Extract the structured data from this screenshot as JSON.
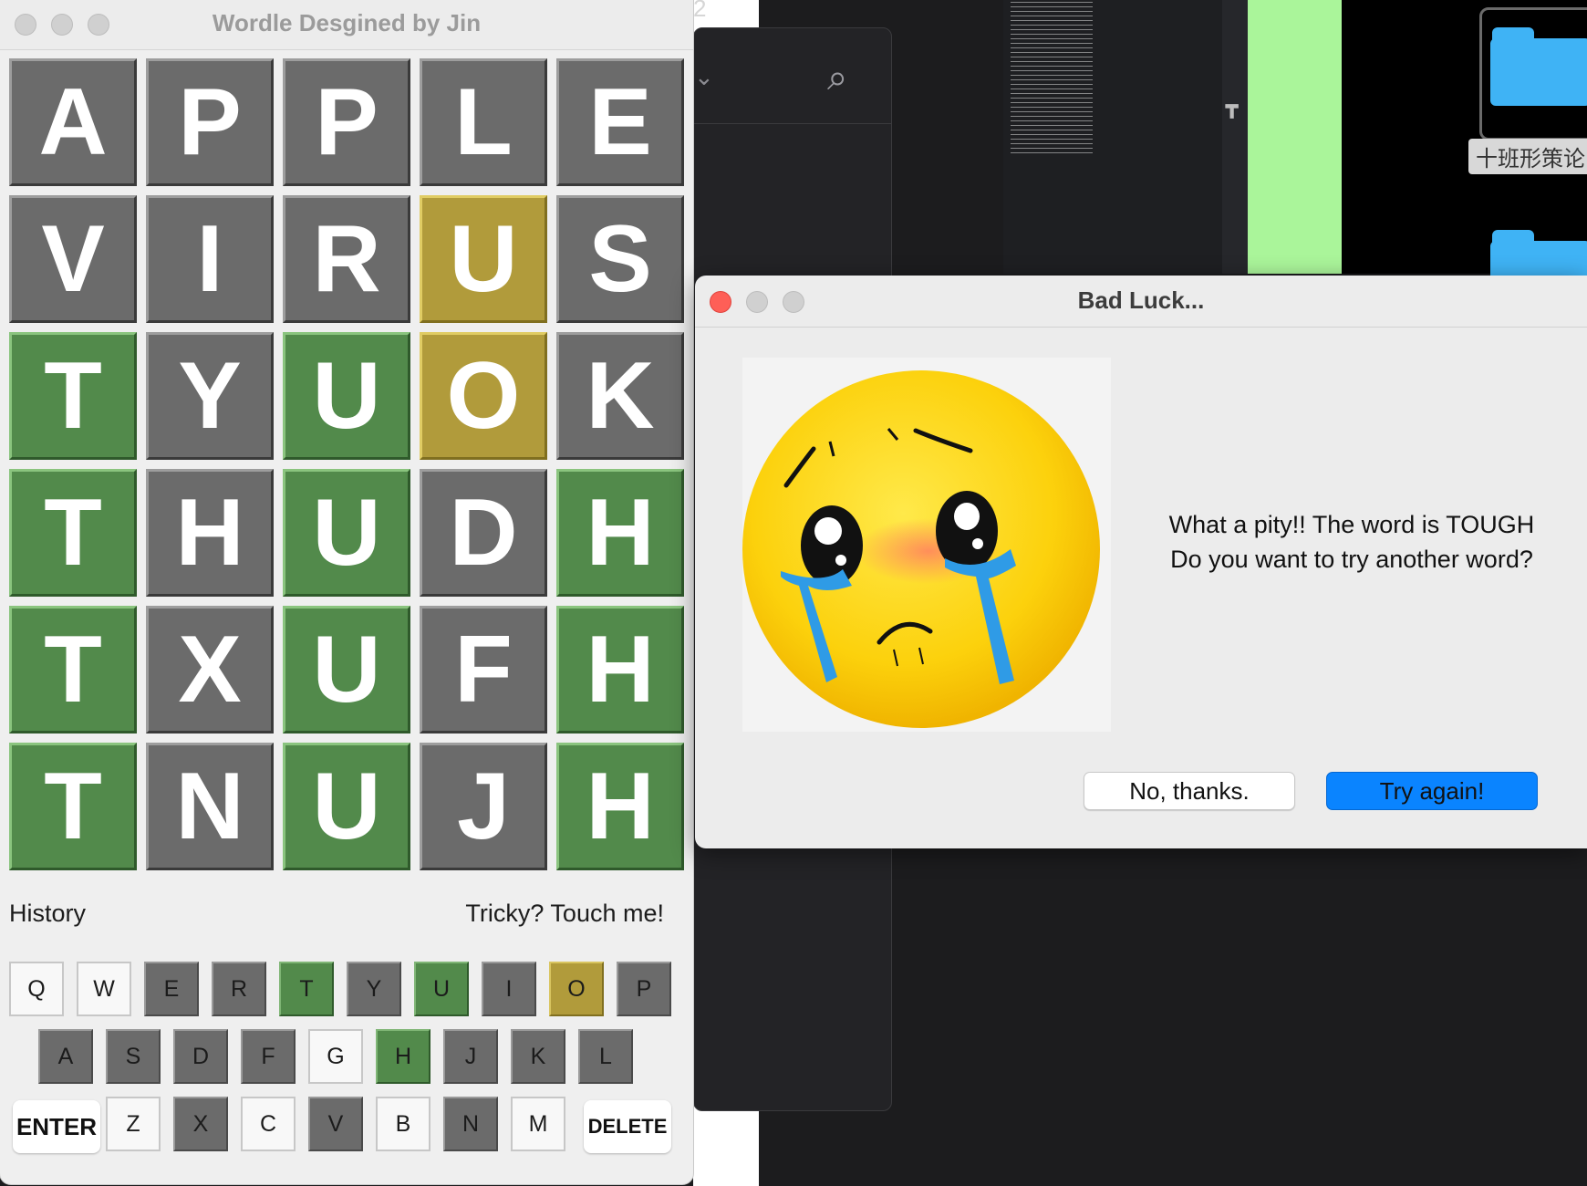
{
  "window": {
    "title": "Wordle Desgined by Jin"
  },
  "board": {
    "rows": [
      [
        {
          "letter": "A",
          "state": "gray"
        },
        {
          "letter": "P",
          "state": "gray"
        },
        {
          "letter": "P",
          "state": "gray"
        },
        {
          "letter": "L",
          "state": "gray"
        },
        {
          "letter": "E",
          "state": "gray"
        }
      ],
      [
        {
          "letter": "V",
          "state": "gray"
        },
        {
          "letter": "I",
          "state": "gray"
        },
        {
          "letter": "R",
          "state": "gray"
        },
        {
          "letter": "U",
          "state": "yellow"
        },
        {
          "letter": "S",
          "state": "gray"
        }
      ],
      [
        {
          "letter": "T",
          "state": "green"
        },
        {
          "letter": "Y",
          "state": "gray"
        },
        {
          "letter": "U",
          "state": "green"
        },
        {
          "letter": "O",
          "state": "yellow"
        },
        {
          "letter": "K",
          "state": "gray"
        }
      ],
      [
        {
          "letter": "T",
          "state": "green"
        },
        {
          "letter": "H",
          "state": "gray"
        },
        {
          "letter": "U",
          "state": "green"
        },
        {
          "letter": "D",
          "state": "gray"
        },
        {
          "letter": "H",
          "state": "green"
        }
      ],
      [
        {
          "letter": "T",
          "state": "green"
        },
        {
          "letter": "X",
          "state": "gray"
        },
        {
          "letter": "U",
          "state": "green"
        },
        {
          "letter": "F",
          "state": "gray"
        },
        {
          "letter": "H",
          "state": "green"
        }
      ],
      [
        {
          "letter": "T",
          "state": "green"
        },
        {
          "letter": "N",
          "state": "gray"
        },
        {
          "letter": "U",
          "state": "green"
        },
        {
          "letter": "J",
          "state": "gray"
        },
        {
          "letter": "H",
          "state": "green"
        }
      ]
    ]
  },
  "links": {
    "history": "History",
    "tricky": "Tricky? Touch me!"
  },
  "keyboard": {
    "row1": [
      {
        "k": "Q",
        "s": "white"
      },
      {
        "k": "W",
        "s": "white"
      },
      {
        "k": "E",
        "s": "gray"
      },
      {
        "k": "R",
        "s": "gray"
      },
      {
        "k": "T",
        "s": "green"
      },
      {
        "k": "Y",
        "s": "gray"
      },
      {
        "k": "U",
        "s": "green"
      },
      {
        "k": "I",
        "s": "gray"
      },
      {
        "k": "O",
        "s": "yellow"
      },
      {
        "k": "P",
        "s": "gray"
      }
    ],
    "row2": [
      {
        "k": "A",
        "s": "gray"
      },
      {
        "k": "S",
        "s": "gray"
      },
      {
        "k": "D",
        "s": "gray"
      },
      {
        "k": "F",
        "s": "gray"
      },
      {
        "k": "G",
        "s": "white"
      },
      {
        "k": "H",
        "s": "green"
      },
      {
        "k": "J",
        "s": "gray"
      },
      {
        "k": "K",
        "s": "gray"
      },
      {
        "k": "L",
        "s": "gray"
      }
    ],
    "row3": [
      {
        "k": "Z",
        "s": "white"
      },
      {
        "k": "X",
        "s": "gray"
      },
      {
        "k": "C",
        "s": "white"
      },
      {
        "k": "V",
        "s": "gray"
      },
      {
        "k": "B",
        "s": "white"
      },
      {
        "k": "N",
        "s": "gray"
      },
      {
        "k": "M",
        "s": "white"
      }
    ],
    "enter": "ENTER",
    "delete": "DELETE"
  },
  "dialog": {
    "title": "Bad Luck...",
    "message_line1": "What a pity!! The word is TOUGH",
    "message_line2": "Do you want to try another word?",
    "no_button": "No, thanks.",
    "yes_button": "Try again!"
  },
  "background": {
    "topright_number": "2",
    "folder_label": "十班形策论"
  },
  "colors": {
    "gray": "#6b6b6b",
    "green": "#528a4b",
    "yellow": "#b19b3b",
    "accent_button": "#0a84ff",
    "close_red": "#fe5f57"
  }
}
